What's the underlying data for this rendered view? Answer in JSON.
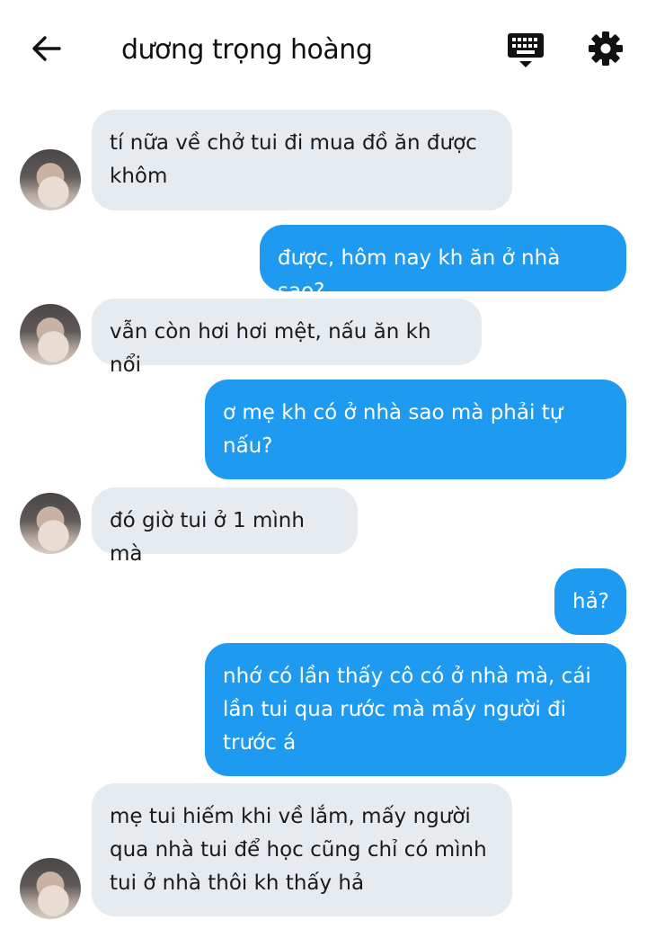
{
  "header": {
    "contact_name": "dương trọng hoàng",
    "back_icon": "arrow-left-icon",
    "keyboard_icon": "keyboard-icon",
    "settings_icon": "gear-icon"
  },
  "messages": [
    {
      "side": "in",
      "text": "tí nữa về chở tui đi mua đồ ăn được\nkhôm"
    },
    {
      "side": "out",
      "text": "được, hôm nay kh ăn ở nhà sao?"
    },
    {
      "side": "in",
      "text": "vẫn còn hơi hơi mệt, nấu ăn kh nổi"
    },
    {
      "side": "out",
      "text": "ơ mẹ kh có ở nhà sao mà phải tự\nnấu?"
    },
    {
      "side": "in",
      "text": "đó giờ tui ở 1 mình mà"
    },
    {
      "side": "out",
      "text": "hả?"
    },
    {
      "side": "out",
      "text": "nhớ có lần thấy cô có ở nhà mà, cái\nlần tui qua rước mà mấy người đi\ntrước á"
    },
    {
      "side": "in",
      "text": "mẹ tui hiếm khi về lắm, mấy người\nqua nhà tui để học cũng chỉ có mình\ntui ở nhà thôi kh thấy hả"
    }
  ],
  "colors": {
    "incoming_bubble": "#e6ebef",
    "outgoing_bubble": "#1e9bf0",
    "outgoing_text": "#ffffff"
  }
}
